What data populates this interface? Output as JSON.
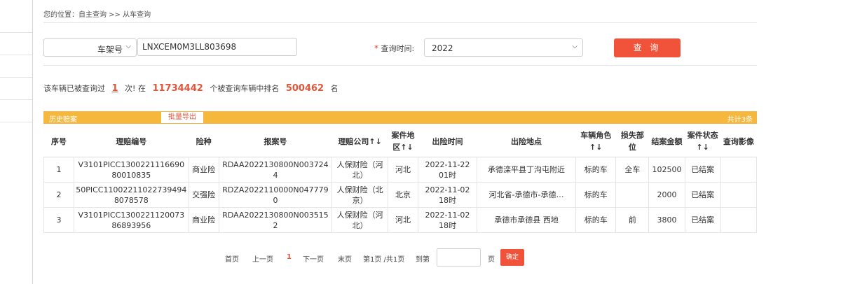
{
  "breadcrumb": "您的位置：自主查询 >> 从车查询",
  "search": {
    "field_type": "车架号",
    "vin_value": "LNXCEM0M3LL803698",
    "required_mark": "*",
    "time_label": "查询时间:",
    "year_value": "2022",
    "query_button": "查 询"
  },
  "stats": {
    "prefix": "该车辆已被查询过",
    "count": "1",
    "mid1": "次! 在",
    "total": "11734442",
    "mid2": "个被查询车辆中排名",
    "rank": "500462",
    "suffix": "名"
  },
  "table_bar": {
    "title": "历史赔案",
    "export_button": "批量导出",
    "total": "共计3条"
  },
  "table": {
    "headers": [
      "序号",
      "理赔编号",
      "险种",
      "报案号",
      "理赔公司↑↓",
      "案件地区↑↓",
      "出险时间",
      "出险地点",
      "车辆角色↑↓",
      "损失部位",
      "结案金额",
      "案件状态↑↓",
      "查询影像"
    ],
    "rows": [
      [
        "1",
        "V3101PICC130022111669080010835",
        "商业险",
        "RDAA2022130800N0037244",
        "人保财险（河北）",
        "河北",
        "2022-11-22 01时",
        "承德滦平县丁沟屯附近",
        "标的车",
        "全车",
        "102500",
        "已结案",
        ""
      ],
      [
        "2",
        "50PICC110022110227394948078578",
        "交强险",
        "RDZA2022110000N0477790",
        "人保财险（北京）",
        "北京",
        "2022-11-02 18时",
        "河北省-承德市-承德…",
        "标的车",
        "",
        "2000",
        "已结案",
        ""
      ],
      [
        "3",
        "V3101PICC130022112007386893956",
        "商业险",
        "RDAA2022130800N0035152",
        "人保财险（河北）",
        "河北",
        "2022-11-02 18时",
        "承德市承德县 西地",
        "标的车",
        "前",
        "3800",
        "已结案",
        ""
      ]
    ]
  },
  "pager": {
    "first": "首页",
    "prev": "上一页",
    "current": "1",
    "next": "下一页",
    "last": "末页",
    "info": "第1页 /共1页",
    "goto": "到第",
    "page_unit": "页",
    "confirm": "确定"
  }
}
